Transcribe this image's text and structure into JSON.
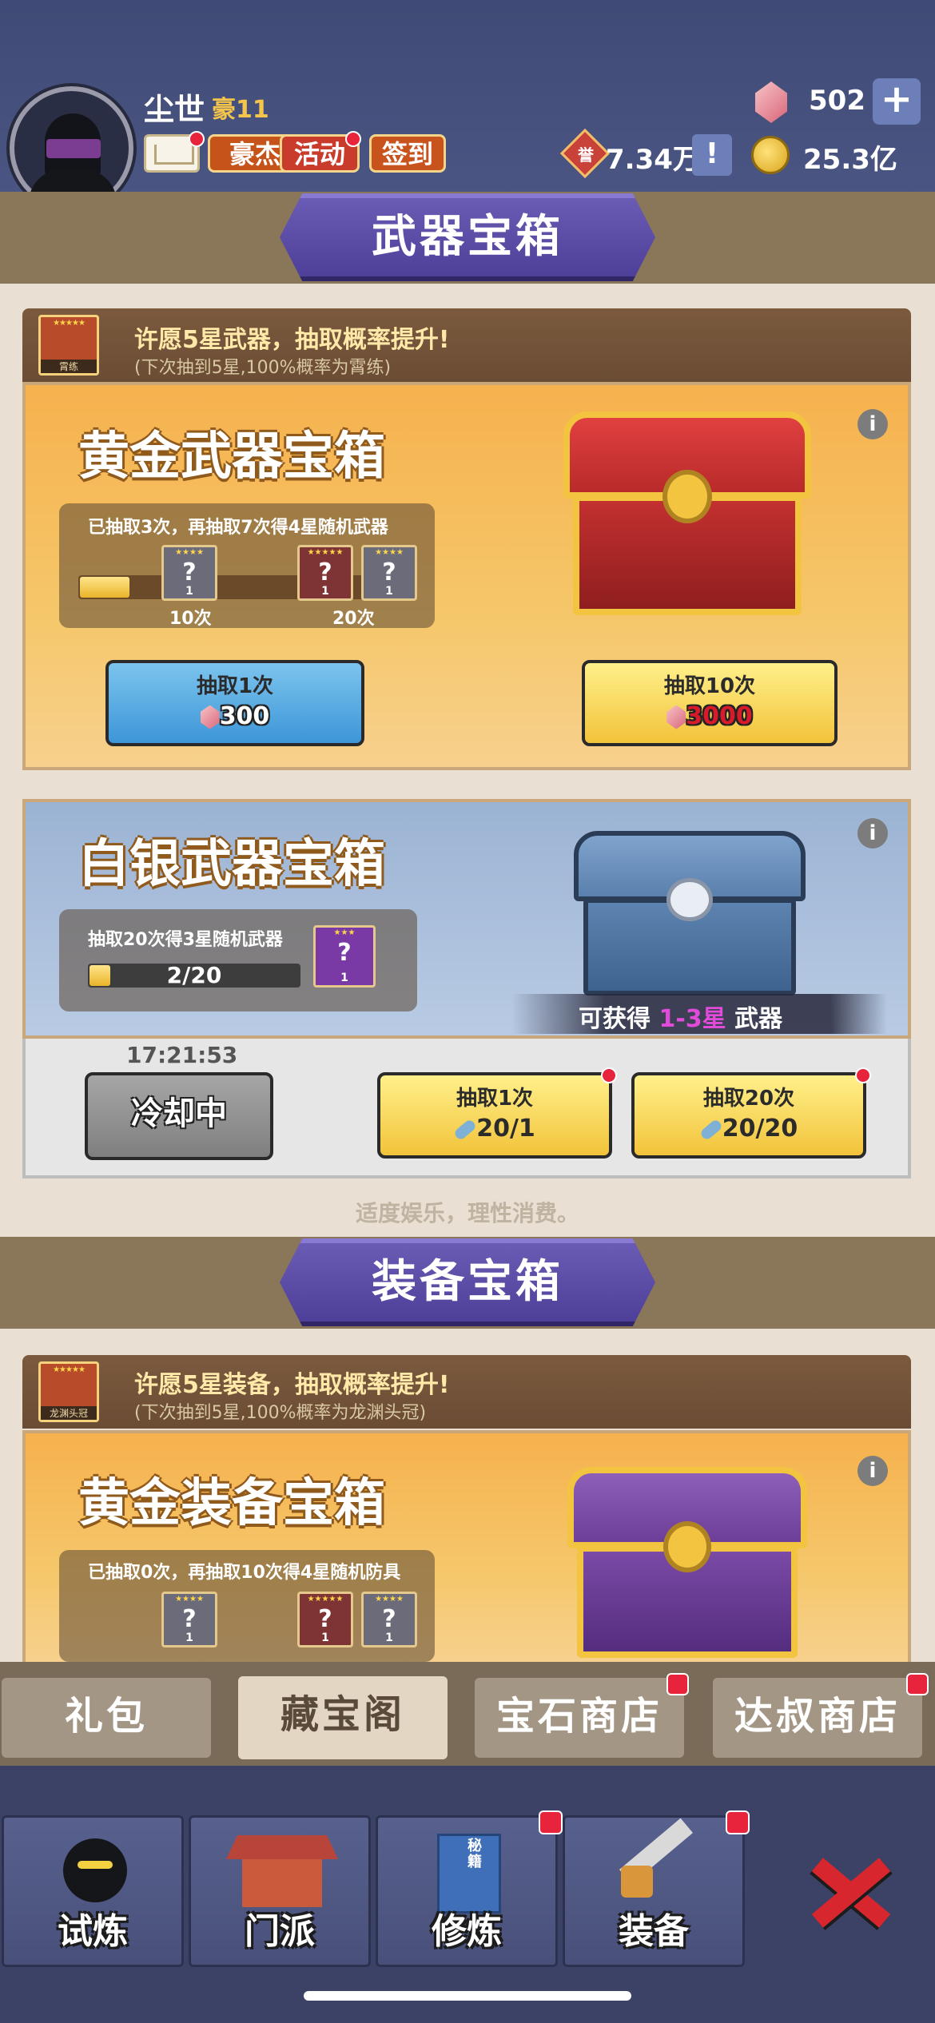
{
  "header": {
    "username": "尘世",
    "vip_label": "豪11",
    "buttons": {
      "hero": "豪杰",
      "event": "活动",
      "checkin": "签到"
    },
    "gems": "502",
    "plus": "+",
    "tickets": "7.34万",
    "ticket_icon_char": "誉",
    "tickets_info": "!",
    "coins": "25.3亿"
  },
  "weapon_section": {
    "banner": "武器宝箱",
    "wish": {
      "title": "许愿5星武器，抽取概率提升!",
      "subtitle": "(下次抽到5星,100%概率为霄练)",
      "icon_label": "霄练",
      "icon_stars": "★★★★★"
    },
    "gold_chest": {
      "title": "黄金武器宝箱",
      "info": "i",
      "progress_text": "已抽取3次，再抽取7次得4星随机武器",
      "progress": 0.15,
      "marks": [
        {
          "label": "10次",
          "stars": "★★★★",
          "count": "1"
        },
        {
          "label": "20次",
          "stars": "★★★★★",
          "count": "1"
        }
      ],
      "extra_reward": {
        "stars": "★★★★",
        "count": "1"
      },
      "draw1": {
        "label": "抽取1次",
        "cost": "300"
      },
      "draw10": {
        "label": "抽取10次",
        "cost": "3000"
      }
    },
    "silver_chest": {
      "title": "白银武器宝箱",
      "info": "i",
      "progress_text": "抽取20次得3星随机武器",
      "progress_value": "2/20",
      "progress": 0.1,
      "reward": {
        "stars": "★★★",
        "count": "1"
      },
      "obtain_prefix": "可获得",
      "obtain_range": "1-3星",
      "obtain_suffix": "武器",
      "timer": "17:21:53",
      "cooldown": "冷却中",
      "draw1": {
        "label": "抽取1次",
        "cost": "20/1"
      },
      "draw20": {
        "label": "抽取20次",
        "cost": "20/20"
      }
    },
    "tagline": "适度娱乐，理性消费。"
  },
  "equip_section": {
    "banner": "装备宝箱",
    "wish": {
      "title": "许愿5星装备，抽取概率提升!",
      "subtitle": "(下次抽到5星,100%概率为龙渊头冠)",
      "icon_label": "龙渊头冠",
      "icon_stars": "★★★★★"
    },
    "gold_chest": {
      "title": "黄金装备宝箱",
      "info": "i",
      "progress_text": "已抽取0次，再抽取10次得4星随机防具",
      "rewards": [
        {
          "stars": "★★★★",
          "count": "1"
        },
        {
          "stars": "★★★★★",
          "count": "1"
        },
        {
          "stars": "★★★★",
          "count": "1"
        }
      ]
    }
  },
  "shop_tabs": [
    "礼包",
    "藏宝阁",
    "宝石商店",
    "达叔商店"
  ],
  "bottom_nav": [
    "试炼",
    "门派",
    "修炼",
    "装备"
  ],
  "book_label": "秘籍",
  "colors": {
    "accent_purple": "#5b4aa8",
    "gold": "#f2c440",
    "badge_red": "#e8243d"
  }
}
